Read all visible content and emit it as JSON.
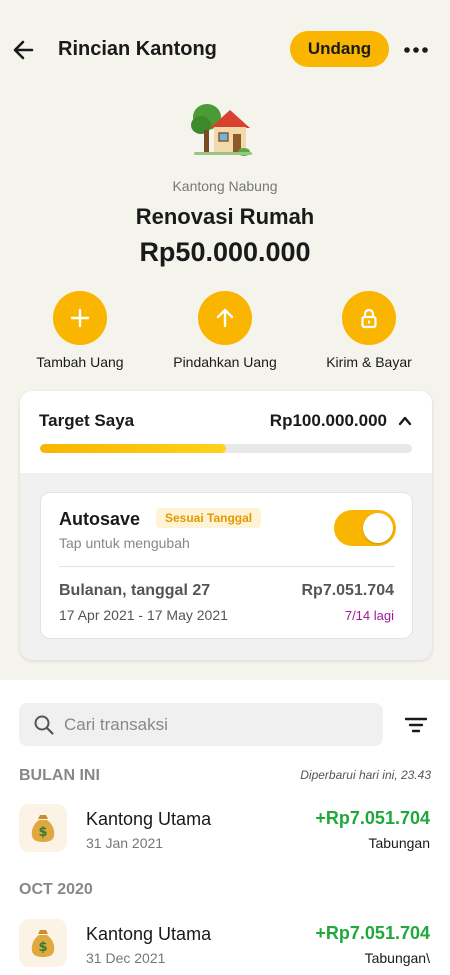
{
  "header": {
    "title": "Rincian Kantong",
    "invite_label": "Undang"
  },
  "pocket": {
    "type": "Kantong Nabung",
    "name": "Renovasi Rumah",
    "balance": "Rp50.000.000"
  },
  "actions": [
    {
      "label": "Tambah Uang",
      "icon": "plus-icon"
    },
    {
      "label": "Pindahkan Uang",
      "icon": "arrow-up-icon"
    },
    {
      "label": "Kirim & Bayar",
      "icon": "lock-icon"
    }
  ],
  "target": {
    "label": "Target Saya",
    "amount": "Rp100.000.000",
    "progress_fraction": 0.5
  },
  "autosave": {
    "title": "Autosave",
    "badge": "Sesuai Tanggal",
    "hint": "Tap untuk mengubah",
    "enabled": true,
    "schedule": "Bulanan, tanggal 27",
    "date_range": "17 Apr 2021 - 17 May 2021",
    "amount": "Rp7.051.704",
    "remaining": "7/14 lagi"
  },
  "search": {
    "placeholder": "Cari transaksi"
  },
  "sections": [
    {
      "title": "BULAN INI",
      "updated": "Diperbarui hari ini, 23.43",
      "items": [
        {
          "name": "Kantong Utama",
          "date": "31 Jan 2021",
          "amount": "+Rp7.051.704",
          "category": "Tabungan"
        }
      ]
    },
    {
      "title": "OCT 2020",
      "items": [
        {
          "name": "Kantong Utama",
          "date": "31 Dec 2021",
          "amount": "+Rp7.051.704",
          "category": "Tabungan\\"
        }
      ]
    }
  ],
  "colors": {
    "accent": "#f9b500",
    "positive": "#20a83c",
    "remaining": "#a0199a",
    "background_top": "#f4f3ec"
  }
}
